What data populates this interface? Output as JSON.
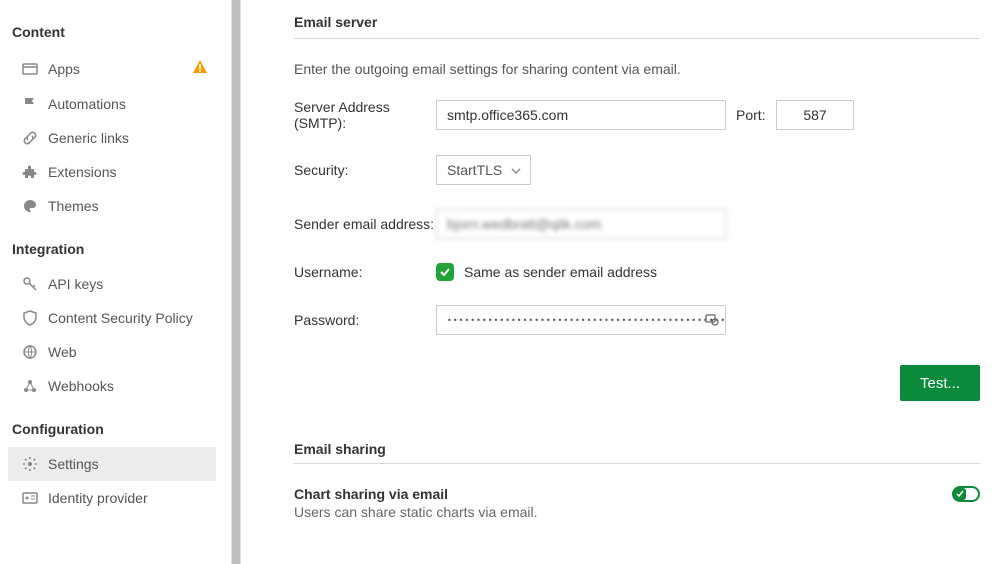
{
  "sidebar": {
    "sections": [
      {
        "title": "Content",
        "items": [
          {
            "label": "Apps",
            "warn": true
          },
          {
            "label": "Automations"
          },
          {
            "label": "Generic links"
          },
          {
            "label": "Extensions"
          },
          {
            "label": "Themes"
          }
        ]
      },
      {
        "title": "Integration",
        "items": [
          {
            "label": "API keys"
          },
          {
            "label": "Content Security Policy"
          },
          {
            "label": "Web"
          },
          {
            "label": "Webhooks"
          }
        ]
      },
      {
        "title": "Configuration",
        "items": [
          {
            "label": "Settings",
            "active": true
          },
          {
            "label": "Identity provider"
          }
        ]
      }
    ]
  },
  "email_server": {
    "title": "Email server",
    "description": "Enter the outgoing email settings for sharing content via email.",
    "server_label": "Server Address (SMTP):",
    "server_value": "smtp.office365.com",
    "port_label": "Port:",
    "port_value": "587",
    "security_label": "Security:",
    "security_value": "StartTLS",
    "sender_label": "Sender email address:",
    "sender_value": "bjorn.wedbratt@qlik.com",
    "username_label": "Username:",
    "username_checkbox": "Same as sender email address",
    "password_label": "Password:",
    "password_mask": "••••••••••••••••••••••••••••••••••••••••••••••••••••••••••••••••",
    "test_button": "Test..."
  },
  "email_sharing": {
    "title": "Email sharing",
    "chart_title": "Chart sharing via email",
    "chart_desc": "Users can share static charts via email.",
    "toggle_on": true
  },
  "colors": {
    "accent": "#0a8a3a",
    "warn": "#f59e0b"
  }
}
